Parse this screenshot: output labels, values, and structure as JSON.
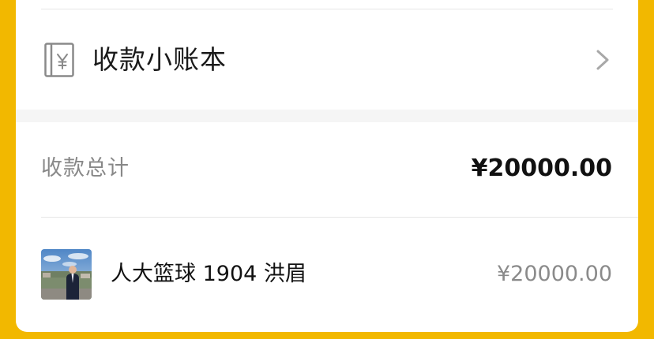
{
  "ledger": {
    "label": "收款小账本",
    "icon": "ledger-yen-icon"
  },
  "summary": {
    "total_label": "收款总计",
    "total_amount": "¥20000.00"
  },
  "payments": [
    {
      "name": "人大篮球 1904 洪眉",
      "amount": "¥20000.00",
      "avatar": "user-avatar"
    }
  ],
  "colors": {
    "background": "#F2B800",
    "card": "#FFFFFF",
    "primary_text": "#111111",
    "secondary_text": "#888888",
    "divider": "#E6E6E6"
  }
}
